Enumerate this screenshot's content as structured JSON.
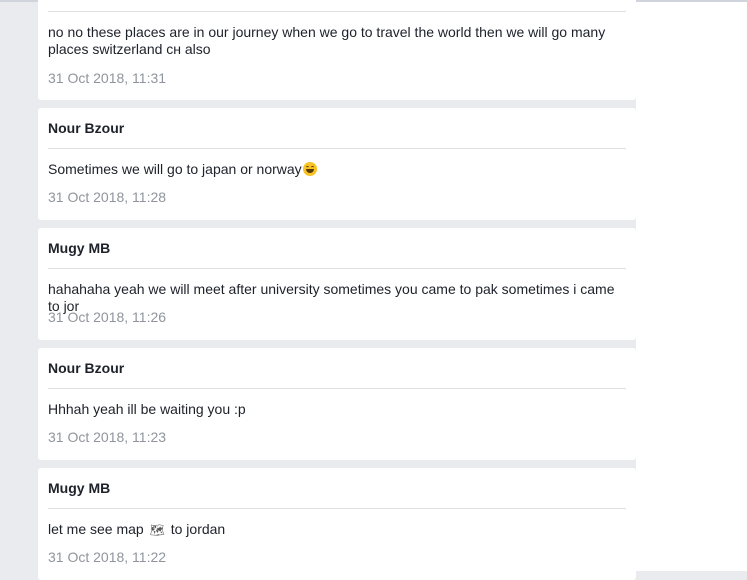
{
  "messages": [
    {
      "author": "",
      "text": "no no these places are in our journey when we go to travel the world then we will go many places switzerland ᴄʜ also",
      "timestamp": "31 Oct 2018, 11:31"
    },
    {
      "author": "Nour Bzour",
      "text": "Sometimes we will go to japan or norway",
      "emoji": "tears-of-joy-emoji",
      "timestamp": "31 Oct 2018, 11:28"
    },
    {
      "author": "Mugy MB",
      "text": "hahahaha yeah we will meet after university sometimes you came to pak sometimes i came to jor",
      "timestamp": "31 Oct 2018, 11:26"
    },
    {
      "author": "Nour Bzour",
      "text": "Hhhah yeah ill be waiting you :p",
      "timestamp": "31 Oct 2018, 11:23"
    },
    {
      "author": "Mugy MB",
      "text_before": "let me see map",
      "icon": "world-map-icon",
      "icon_glyph": "🗺",
      "text_after": "to jordan",
      "timestamp": "31 Oct 2018, 11:22"
    }
  ],
  "colors": {
    "background": "#e9ebee",
    "card": "#ffffff",
    "text": "#1d2129",
    "timestamp": "#90949c",
    "divider": "#dddfe2"
  }
}
